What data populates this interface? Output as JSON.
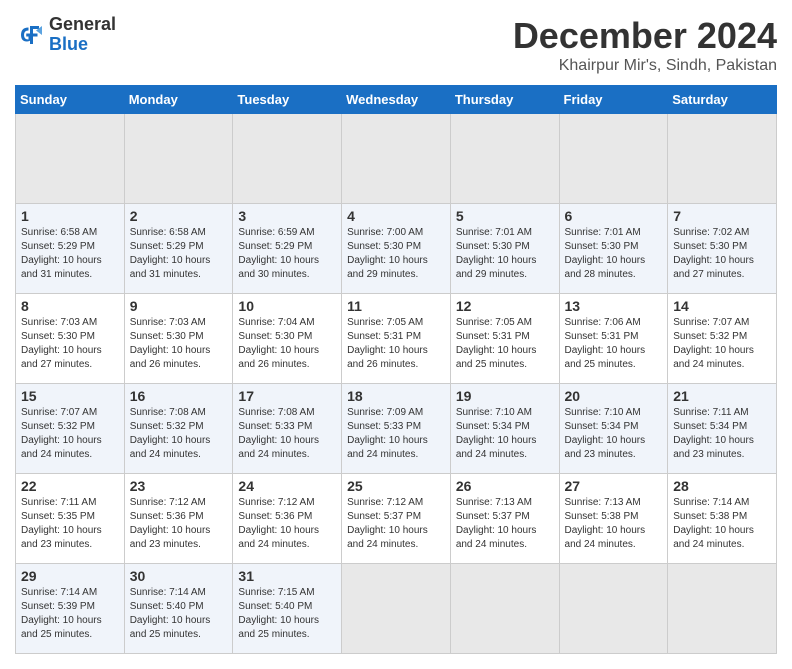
{
  "header": {
    "logo_general": "General",
    "logo_blue": "Blue",
    "month_title": "December 2024",
    "location": "Khairpur Mir's, Sindh, Pakistan"
  },
  "calendar": {
    "days_of_week": [
      "Sunday",
      "Monday",
      "Tuesday",
      "Wednesday",
      "Thursday",
      "Friday",
      "Saturday"
    ],
    "weeks": [
      [
        {
          "day": "",
          "empty": true
        },
        {
          "day": "",
          "empty": true
        },
        {
          "day": "",
          "empty": true
        },
        {
          "day": "",
          "empty": true
        },
        {
          "day": "",
          "empty": true
        },
        {
          "day": "",
          "empty": true
        },
        {
          "day": "",
          "empty": true
        }
      ],
      [
        {
          "day": "1",
          "sunrise": "Sunrise: 6:58 AM",
          "sunset": "Sunset: 5:29 PM",
          "daylight": "Daylight: 10 hours and 31 minutes."
        },
        {
          "day": "2",
          "sunrise": "Sunrise: 6:58 AM",
          "sunset": "Sunset: 5:29 PM",
          "daylight": "Daylight: 10 hours and 31 minutes."
        },
        {
          "day": "3",
          "sunrise": "Sunrise: 6:59 AM",
          "sunset": "Sunset: 5:29 PM",
          "daylight": "Daylight: 10 hours and 30 minutes."
        },
        {
          "day": "4",
          "sunrise": "Sunrise: 7:00 AM",
          "sunset": "Sunset: 5:30 PM",
          "daylight": "Daylight: 10 hours and 29 minutes."
        },
        {
          "day": "5",
          "sunrise": "Sunrise: 7:01 AM",
          "sunset": "Sunset: 5:30 PM",
          "daylight": "Daylight: 10 hours and 29 minutes."
        },
        {
          "day": "6",
          "sunrise": "Sunrise: 7:01 AM",
          "sunset": "Sunset: 5:30 PM",
          "daylight": "Daylight: 10 hours and 28 minutes."
        },
        {
          "day": "7",
          "sunrise": "Sunrise: 7:02 AM",
          "sunset": "Sunset: 5:30 PM",
          "daylight": "Daylight: 10 hours and 27 minutes."
        }
      ],
      [
        {
          "day": "8",
          "sunrise": "Sunrise: 7:03 AM",
          "sunset": "Sunset: 5:30 PM",
          "daylight": "Daylight: 10 hours and 27 minutes."
        },
        {
          "day": "9",
          "sunrise": "Sunrise: 7:03 AM",
          "sunset": "Sunset: 5:30 PM",
          "daylight": "Daylight: 10 hours and 26 minutes."
        },
        {
          "day": "10",
          "sunrise": "Sunrise: 7:04 AM",
          "sunset": "Sunset: 5:30 PM",
          "daylight": "Daylight: 10 hours and 26 minutes."
        },
        {
          "day": "11",
          "sunrise": "Sunrise: 7:05 AM",
          "sunset": "Sunset: 5:31 PM",
          "daylight": "Daylight: 10 hours and 26 minutes."
        },
        {
          "day": "12",
          "sunrise": "Sunrise: 7:05 AM",
          "sunset": "Sunset: 5:31 PM",
          "daylight": "Daylight: 10 hours and 25 minutes."
        },
        {
          "day": "13",
          "sunrise": "Sunrise: 7:06 AM",
          "sunset": "Sunset: 5:31 PM",
          "daylight": "Daylight: 10 hours and 25 minutes."
        },
        {
          "day": "14",
          "sunrise": "Sunrise: 7:07 AM",
          "sunset": "Sunset: 5:32 PM",
          "daylight": "Daylight: 10 hours and 24 minutes."
        }
      ],
      [
        {
          "day": "15",
          "sunrise": "Sunrise: 7:07 AM",
          "sunset": "Sunset: 5:32 PM",
          "daylight": "Daylight: 10 hours and 24 minutes."
        },
        {
          "day": "16",
          "sunrise": "Sunrise: 7:08 AM",
          "sunset": "Sunset: 5:32 PM",
          "daylight": "Daylight: 10 hours and 24 minutes."
        },
        {
          "day": "17",
          "sunrise": "Sunrise: 7:08 AM",
          "sunset": "Sunset: 5:33 PM",
          "daylight": "Daylight: 10 hours and 24 minutes."
        },
        {
          "day": "18",
          "sunrise": "Sunrise: 7:09 AM",
          "sunset": "Sunset: 5:33 PM",
          "daylight": "Daylight: 10 hours and 24 minutes."
        },
        {
          "day": "19",
          "sunrise": "Sunrise: 7:10 AM",
          "sunset": "Sunset: 5:34 PM",
          "daylight": "Daylight: 10 hours and 24 minutes."
        },
        {
          "day": "20",
          "sunrise": "Sunrise: 7:10 AM",
          "sunset": "Sunset: 5:34 PM",
          "daylight": "Daylight: 10 hours and 23 minutes."
        },
        {
          "day": "21",
          "sunrise": "Sunrise: 7:11 AM",
          "sunset": "Sunset: 5:34 PM",
          "daylight": "Daylight: 10 hours and 23 minutes."
        }
      ],
      [
        {
          "day": "22",
          "sunrise": "Sunrise: 7:11 AM",
          "sunset": "Sunset: 5:35 PM",
          "daylight": "Daylight: 10 hours and 23 minutes."
        },
        {
          "day": "23",
          "sunrise": "Sunrise: 7:12 AM",
          "sunset": "Sunset: 5:36 PM",
          "daylight": "Daylight: 10 hours and 23 minutes."
        },
        {
          "day": "24",
          "sunrise": "Sunrise: 7:12 AM",
          "sunset": "Sunset: 5:36 PM",
          "daylight": "Daylight: 10 hours and 24 minutes."
        },
        {
          "day": "25",
          "sunrise": "Sunrise: 7:12 AM",
          "sunset": "Sunset: 5:37 PM",
          "daylight": "Daylight: 10 hours and 24 minutes."
        },
        {
          "day": "26",
          "sunrise": "Sunrise: 7:13 AM",
          "sunset": "Sunset: 5:37 PM",
          "daylight": "Daylight: 10 hours and 24 minutes."
        },
        {
          "day": "27",
          "sunrise": "Sunrise: 7:13 AM",
          "sunset": "Sunset: 5:38 PM",
          "daylight": "Daylight: 10 hours and 24 minutes."
        },
        {
          "day": "28",
          "sunrise": "Sunrise: 7:14 AM",
          "sunset": "Sunset: 5:38 PM",
          "daylight": "Daylight: 10 hours and 24 minutes."
        }
      ],
      [
        {
          "day": "29",
          "sunrise": "Sunrise: 7:14 AM",
          "sunset": "Sunset: 5:39 PM",
          "daylight": "Daylight: 10 hours and 25 minutes."
        },
        {
          "day": "30",
          "sunrise": "Sunrise: 7:14 AM",
          "sunset": "Sunset: 5:40 PM",
          "daylight": "Daylight: 10 hours and 25 minutes."
        },
        {
          "day": "31",
          "sunrise": "Sunrise: 7:15 AM",
          "sunset": "Sunset: 5:40 PM",
          "daylight": "Daylight: 10 hours and 25 minutes."
        },
        {
          "day": "",
          "empty": true
        },
        {
          "day": "",
          "empty": true
        },
        {
          "day": "",
          "empty": true
        },
        {
          "day": "",
          "empty": true
        }
      ]
    ]
  }
}
